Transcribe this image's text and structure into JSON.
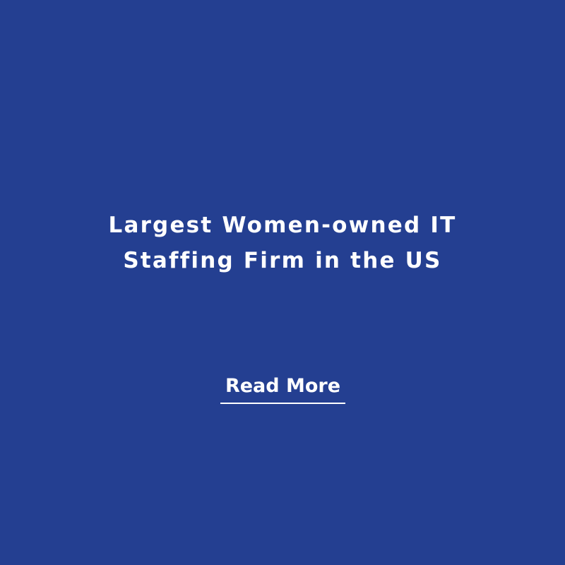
{
  "card": {
    "background_color": "#243f91",
    "headline": {
      "line1": "Largest Women-owned IT",
      "line2": "Staffing Firm in the US"
    },
    "link": {
      "label": "Read More"
    },
    "text_color": "#ffffff"
  }
}
